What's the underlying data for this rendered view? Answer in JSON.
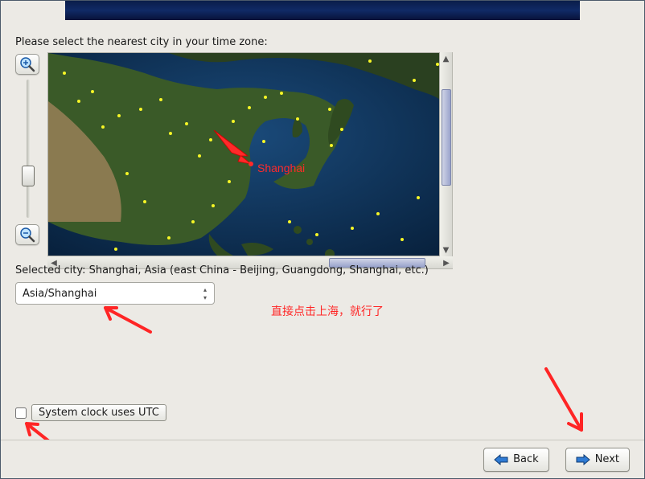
{
  "banner": {
    "present": true
  },
  "prompt": "Please select the nearest city in your time zone:",
  "map": {
    "zoom_in_icon": "zoom-in-icon",
    "zoom_out_icon": "zoom-out-icon",
    "marker_label": "Shanghai",
    "marker_color": "#ff2a2a",
    "city_dot_color": "#f6f626"
  },
  "selected_city_line": "Selected city: Shanghai, Asia (east China - Beijing, Guangdong, Shanghai, etc.)",
  "timezone": {
    "value": "Asia/Shanghai"
  },
  "utc": {
    "checkbox_checked": false,
    "label": "System clock uses UTC"
  },
  "annotations": {
    "hint_text": "直接点击上海，就行了",
    "color": "#ff2525"
  },
  "nav": {
    "back_label": "Back",
    "next_label": "Next"
  }
}
